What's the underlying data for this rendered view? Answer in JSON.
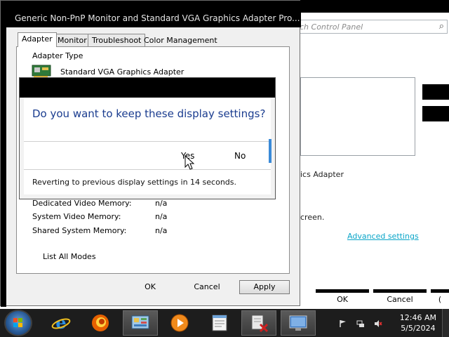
{
  "control_panel": {
    "search_placeholder": "ch Control Panel",
    "adapter_text": "ics Adapter",
    "screen_text": "creen.",
    "advanced_link": "Advanced settings",
    "buttons": {
      "ok": "OK",
      "cancel": "Cancel",
      "apply_partial": "("
    }
  },
  "properties": {
    "title": "Generic Non-PnP Monitor and Standard VGA Graphics Adapter Pro...",
    "tabs": [
      "Adapter",
      "Monitor",
      "Troubleshoot",
      "Color Management"
    ],
    "adapter_type_label": "Adapter Type",
    "adapter_name": "Standard VGA Graphics Adapter",
    "memory": [
      {
        "label": "Dedicated Video Memory:",
        "value": "n/a"
      },
      {
        "label": "System Video Memory:",
        "value": "n/a"
      },
      {
        "label": "Shared System Memory:",
        "value": "n/a"
      }
    ],
    "list_modes": "List All Modes",
    "buttons": {
      "ok": "OK",
      "cancel": "Cancel",
      "apply": "Apply"
    }
  },
  "confirm": {
    "question": "Do you want to keep these display settings?",
    "yes": "Yes",
    "no": "No",
    "status": "Reverting to previous display settings in 14 seconds."
  },
  "taskbar": {
    "apps": [
      "internet-explorer",
      "firefox",
      "control-panel",
      "media-player",
      "notepad",
      "setup-tool",
      "display-settings"
    ],
    "time": "12:46 AM",
    "date": "5/5/2024"
  },
  "colors": {
    "title_blue": "#1a3c8f",
    "link": "#0aa5c8",
    "accent": "#3a8ad8"
  }
}
